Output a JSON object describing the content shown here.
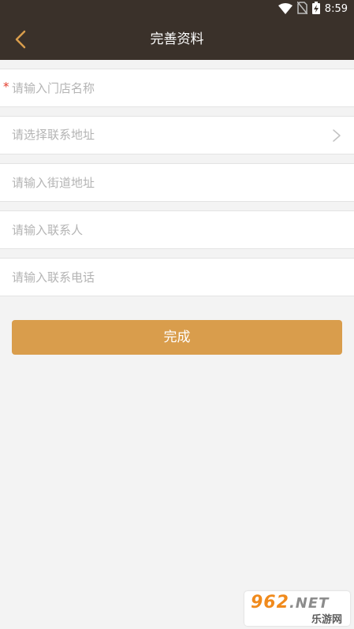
{
  "status_bar": {
    "time": "8:59",
    "icons": [
      "wifi-icon",
      "no-sim-icon",
      "battery-charging-icon"
    ]
  },
  "app_bar": {
    "title": "完善资料",
    "back_icon": "chevron-left-icon"
  },
  "form": {
    "store_name": {
      "placeholder": "请输入门店名称",
      "required_mark": "*",
      "value": ""
    },
    "contact_address": {
      "placeholder": "请选择联系地址",
      "icon": "chevron-right-icon"
    },
    "street_address": {
      "placeholder": "请输入街道地址",
      "value": ""
    },
    "contact_person": {
      "placeholder": "请输入联系人",
      "value": ""
    },
    "contact_phone": {
      "placeholder": "请输入联系电话",
      "value": ""
    }
  },
  "submit": {
    "label": "完成"
  },
  "watermark": {
    "number": "962",
    "suffix": ".NET",
    "subtitle": "乐游网"
  },
  "colors": {
    "header_bg": "#3a312a",
    "page_bg": "#f3f3f3",
    "accent": "#d99d4c",
    "required": "#e23a2a",
    "placeholder": "#b4b4b4"
  }
}
